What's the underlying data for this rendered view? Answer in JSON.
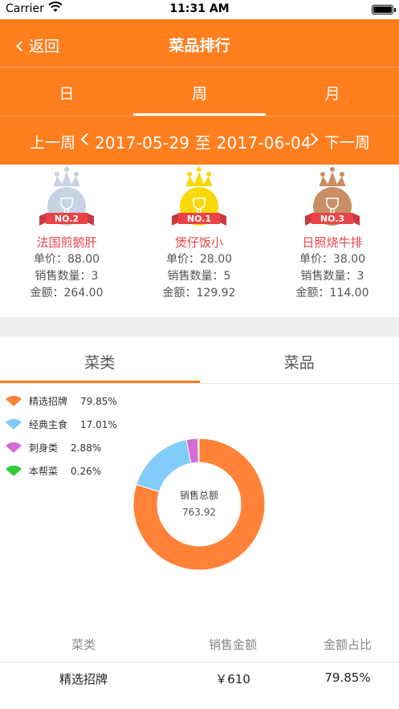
{
  "status_bar": {
    "carrier": "Carrier",
    "time": "11:31 AM"
  },
  "nav": {
    "back_label": "返回",
    "title": "菜品排行"
  },
  "period_tabs": [
    {
      "label": "日"
    },
    {
      "label": "周"
    },
    {
      "label": "月"
    }
  ],
  "period_active": "周",
  "range": {
    "prev_label": "上一周",
    "text": "2017-05-29 至 2017-06-04",
    "next_label": "下一周"
  },
  "ranking": [
    {
      "badge": "NO.2",
      "name": "法国煎鹅肝",
      "price": "单价：88.00",
      "qty": "销售数量：3",
      "amount": "金额：264.00",
      "color": "#c7d3e3"
    },
    {
      "badge": "NO.1",
      "name": "煲仔饭小",
      "price": "单价：28.00",
      "qty": "销售数量：5",
      "amount": "金额：129.92",
      "color": "#f7d90a"
    },
    {
      "badge": "NO.3",
      "name": "日照烧牛排",
      "price": "单价：38.00",
      "qty": "销售数量：3",
      "amount": "金额：114.00",
      "color": "#c98e64"
    }
  ],
  "category_tabs": [
    {
      "label": "菜类"
    },
    {
      "label": "菜品"
    }
  ],
  "chart_data": {
    "type": "pie",
    "center_title": "销售总额",
    "center_value": "763.92",
    "series": [
      {
        "name": "精选招牌",
        "percent": "79.85%",
        "value": 79.85,
        "color": "#ff8238"
      },
      {
        "name": "经典主食",
        "percent": "17.01%",
        "value": 17.01,
        "color": "#82ccfa"
      },
      {
        "name": "刺身类",
        "percent": "2.88%",
        "value": 2.88,
        "color": "#d46ed6"
      },
      {
        "name": "本帮菜",
        "percent": "0.26%",
        "value": 0.26,
        "color": "#33cc33"
      }
    ]
  },
  "table": {
    "headers": [
      "菜类",
      "销售金额",
      "金额占比"
    ],
    "rows": [
      [
        "精选招牌",
        "￥610",
        "79.85%"
      ]
    ]
  }
}
